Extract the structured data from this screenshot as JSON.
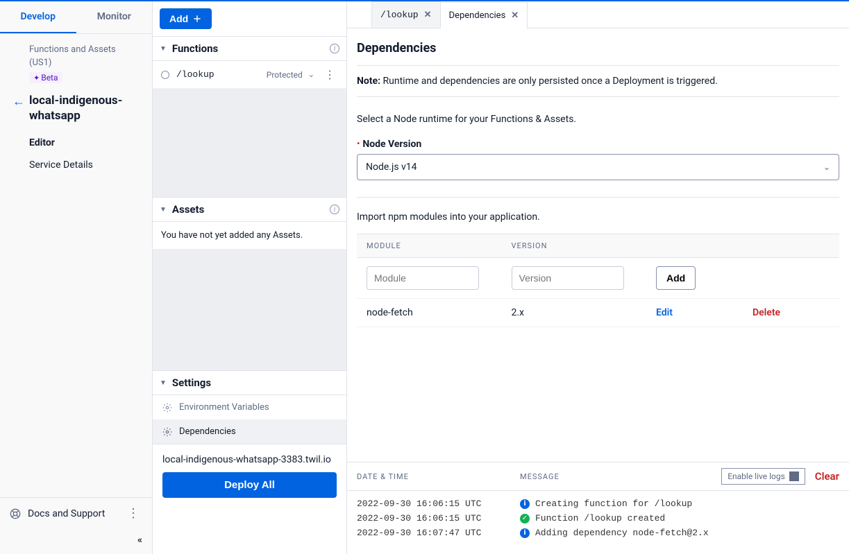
{
  "sidebar": {
    "tabs": {
      "develop": "Develop",
      "monitor": "Monitor"
    },
    "breadcrumb_title": "Functions and Assets",
    "region": "(US1)",
    "badge": "Beta",
    "service_name": "local-indigenous-whatsapp",
    "nav": {
      "editor": "Editor",
      "details": "Service Details"
    },
    "docs": "Docs and Support"
  },
  "middle": {
    "add_button": "Add",
    "sections": {
      "functions": {
        "title": "Functions"
      },
      "assets": {
        "title": "Assets",
        "empty": "You have not yet added any Assets."
      },
      "settings": {
        "title": "Settings",
        "env_vars": "Environment Variables",
        "dependencies": "Dependencies"
      }
    },
    "function_items": [
      {
        "path": "/lookup",
        "visibility": "Protected"
      }
    ],
    "service_url": "local-indigenous-whatsapp-3383.twil.io",
    "deploy_button": "Deploy All"
  },
  "editor_tabs": [
    {
      "label": "/lookup",
      "mono": true,
      "active": false
    },
    {
      "label": "Dependencies",
      "mono": false,
      "active": true
    }
  ],
  "dependencies": {
    "title": "Dependencies",
    "note_label": "Note: ",
    "note_text": "Runtime and dependencies are only persisted once a Deployment is triggered.",
    "runtime_prompt": "Select a Node runtime for your Functions & Assets.",
    "node_label": "Node Version",
    "node_value": "Node.js v14",
    "npm_prompt": "Import npm modules into your application.",
    "table": {
      "module_header": "MODULE",
      "version_header": "VERSION",
      "module_placeholder": "Module",
      "version_placeholder": "Version",
      "add_button": "Add",
      "rows": [
        {
          "module": "node-fetch",
          "version": "2.x",
          "edit": "Edit",
          "delete": "Delete"
        }
      ]
    }
  },
  "logs": {
    "date_header": "DATE & TIME",
    "message_header": "MESSAGE",
    "live_logs": "Enable live logs",
    "clear": "Clear",
    "rows": [
      {
        "ts": "2022-09-30 16:06:15 UTC",
        "type": "info",
        "msg": "Creating function for /lookup"
      },
      {
        "ts": "2022-09-30 16:06:15 UTC",
        "type": "success",
        "msg": "Function /lookup created"
      },
      {
        "ts": "2022-09-30 16:07:47 UTC",
        "type": "info",
        "msg": "Adding dependency node-fetch@2.x"
      }
    ]
  }
}
